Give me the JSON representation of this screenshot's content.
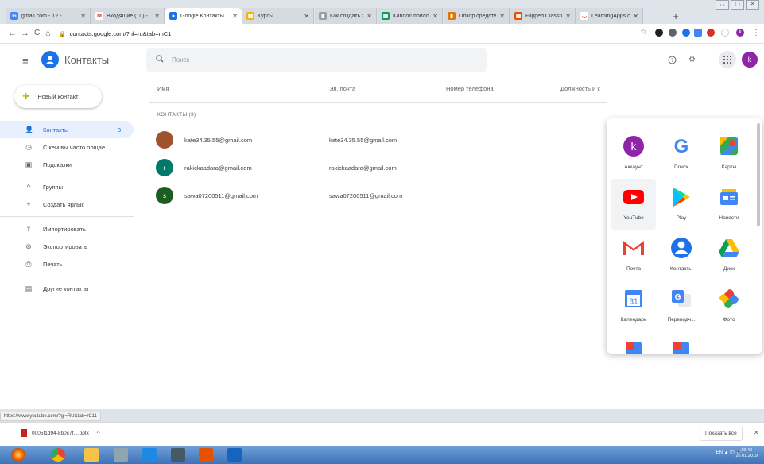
{
  "browser": {
    "tabs": [
      {
        "label": "gmail.com - Т2 -",
        "fav_color": "#4285f4",
        "fav_char": "G"
      },
      {
        "label": "Входящие (10) -",
        "fav_color": "#ffffff",
        "fav_char": "M"
      },
      {
        "label": "Google Контакты",
        "fav_color": "#1a73e8",
        "fav_char": "●",
        "active": true
      },
      {
        "label": "Курсы",
        "fav_color": "#f4b400",
        "fav_char": "▦"
      },
      {
        "label": "Как создать эле",
        "fav_color": "#9e9e9e",
        "fav_char": "▮"
      },
      {
        "label": "Kahoot! прилож",
        "fav_color": "#0f9d58",
        "fav_char": "▦"
      },
      {
        "label": "Обзор средств",
        "fav_color": "#e37400",
        "fav_char": "▮"
      },
      {
        "label": "Flipped Classroo",
        "fav_color": "#e65100",
        "fav_char": "▦"
      },
      {
        "label": "LearningApps.or",
        "fav_color": "#ffffff",
        "fav_char": "◡"
      }
    ],
    "tab_close": "✕",
    "new_tab": "+",
    "window_controls": [
      "◡",
      "▢",
      "✕"
    ],
    "nav": {
      "back": "←",
      "forward": "→",
      "reload": "C",
      "home": "⌂"
    },
    "url": "contacts.google.com/?hl=ru&tab=mC1",
    "lock": "🔒",
    "star": "☆"
  },
  "header": {
    "menu_icon": "≡",
    "app_title": "Контакты",
    "search_icon": "🔍",
    "search_placeholder": "Поиск",
    "help_icon": "?",
    "settings_icon": "⚙",
    "apps_icon": "⋮⋮⋮",
    "account_initial": "k",
    "account_color": "#8e24aa"
  },
  "new_contact": {
    "label": "Новый контакт",
    "plus": "+"
  },
  "sidebar": {
    "items": [
      {
        "label": "Контакты",
        "icon": "👤",
        "count": "3",
        "active": true
      },
      {
        "label": "С кем вы часто общае...",
        "icon": "◷"
      },
      {
        "label": "Подсказки",
        "icon": "▣"
      },
      {
        "label": "Группы",
        "icon": "^",
        "gap": true
      },
      {
        "label": "Создать ярлык",
        "icon": "+"
      },
      {
        "label": "Импортировать",
        "icon": "⇪",
        "divider": true
      },
      {
        "label": "Экспортировать",
        "icon": "⊛"
      },
      {
        "label": "Печать",
        "icon": "⎙"
      },
      {
        "label": "Другие контакты",
        "icon": "▤",
        "divider": true
      }
    ]
  },
  "table": {
    "headers": [
      "Имя",
      "Эл. почта",
      "Номер телефона",
      "Должность и к"
    ],
    "section_label": "КОНТАКТЫ (3)",
    "rows": [
      {
        "name": "kate34.35.55@gmail.com",
        "email": "kate34.35.55@gmail.com",
        "avatar_char": "",
        "avatar_color": "#a0522d"
      },
      {
        "name": "rakickaadara@gmail.com",
        "email": "rakickaadara@gmail.com",
        "avatar_char": "r",
        "avatar_color": "#00796b"
      },
      {
        "name": "sawa07200511@gmail.com",
        "email": "sawa07200511@gmail.com",
        "avatar_char": "s",
        "avatar_color": "#1b5e20"
      }
    ]
  },
  "apps_panel": {
    "items": [
      {
        "label": "Аккаунт",
        "icon": "account-icon"
      },
      {
        "label": "Поиск",
        "icon": "google-search-icon"
      },
      {
        "label": "Карты",
        "icon": "maps-icon"
      },
      {
        "label": "YouTube",
        "icon": "youtube-icon",
        "selected": true
      },
      {
        "label": "Play",
        "icon": "play-icon"
      },
      {
        "label": "Новости",
        "icon": "news-icon"
      },
      {
        "label": "Почта",
        "icon": "gmail-icon"
      },
      {
        "label": "Контакты",
        "icon": "contacts-icon"
      },
      {
        "label": "Диск",
        "icon": "drive-icon"
      },
      {
        "label": "Календарь",
        "icon": "calendar-icon"
      },
      {
        "label": "Переводч...",
        "icon": "translate-icon"
      },
      {
        "label": "Фото",
        "icon": "photos-icon"
      },
      {
        "label": "",
        "icon": "more-app-icon"
      },
      {
        "label": "",
        "icon": "more-app-icon"
      }
    ],
    "calendar_day": "31",
    "account_letter": "k",
    "search_letter": "G"
  },
  "status_url": "https://www.youtube.com/?gl=RU&tab=rC11",
  "downloads": {
    "item": "0005f1d94-8b0c7f....pptx",
    "chevron": "^",
    "show_all": "Показать все",
    "close": "✕"
  },
  "taskbar": {
    "tray_text": "EN ▲ ◫ 🔊",
    "time": "10:49",
    "date": "26.01.2019"
  }
}
